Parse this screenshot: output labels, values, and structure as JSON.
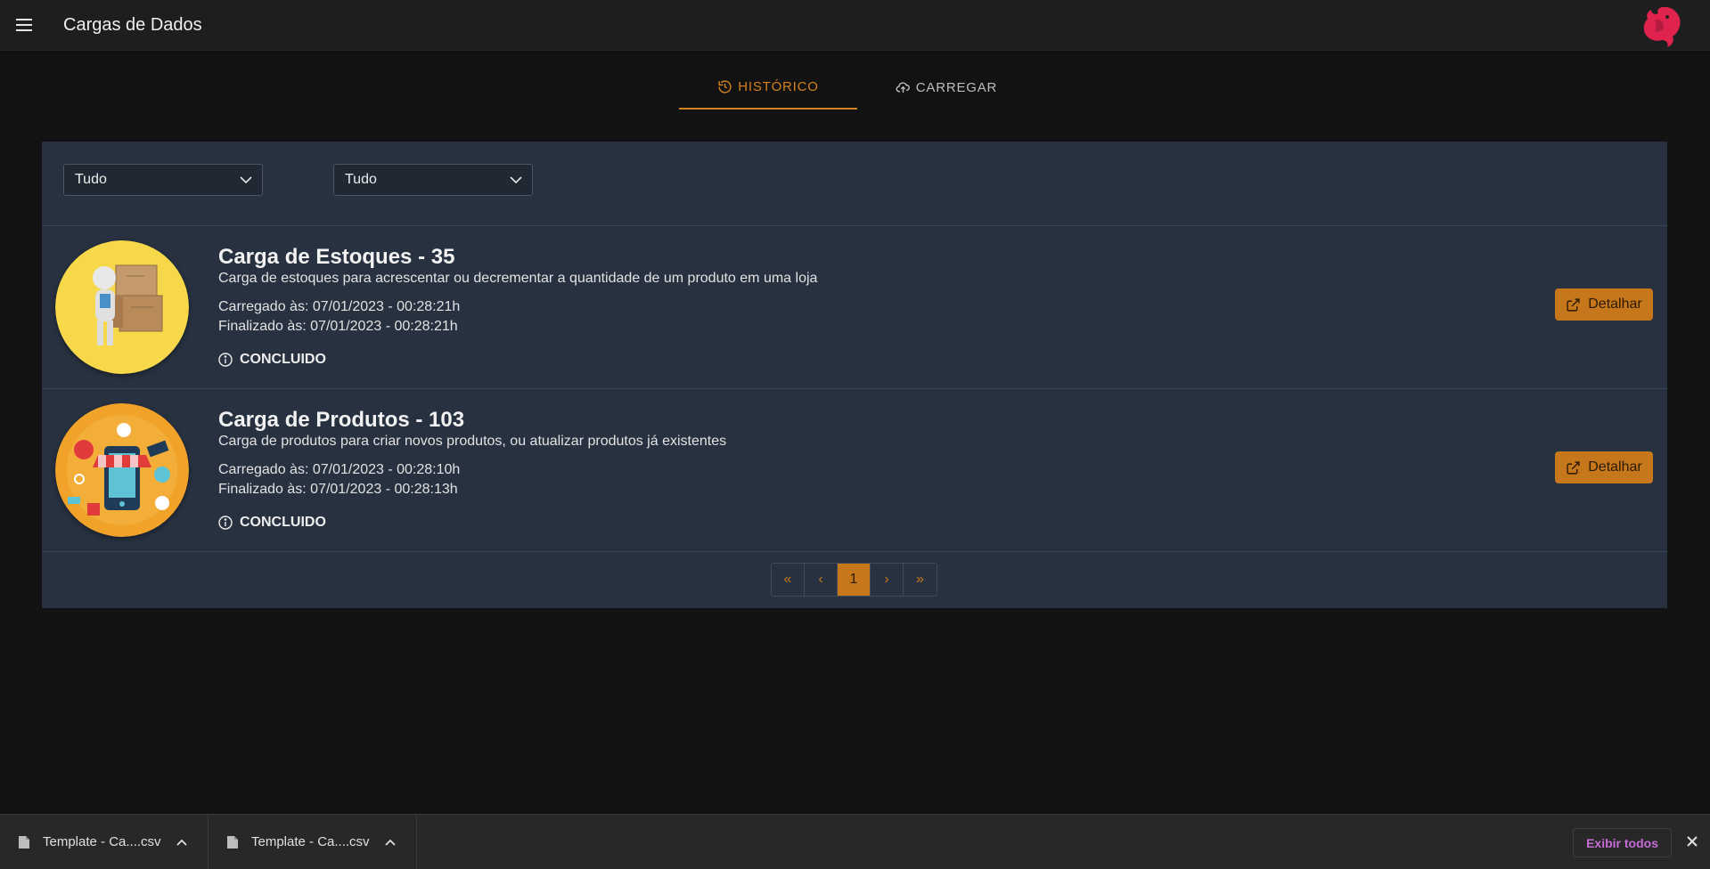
{
  "appbar": {
    "title": "Cargas de Dados"
  },
  "tabs": [
    {
      "label": "HISTÓRICO",
      "icon": "history-icon",
      "active": true
    },
    {
      "label": "CARREGAR",
      "icon": "cloud-upload-icon",
      "active": false
    }
  ],
  "filters": [
    {
      "value": "Tudo"
    },
    {
      "value": "Tudo"
    }
  ],
  "items": [
    {
      "title": "Carga de Estoques - 35",
      "description": "Carga de estoques para acrescentar ou decrementar a quantidade de um produto em uma loja",
      "loaded": "Carregado às: 07/01/2023 - 00:28:21h",
      "finished": "Finalizado às: 07/01/2023 - 00:28:21h",
      "status": "CONCLUIDO",
      "button": "Detalhar"
    },
    {
      "title": "Carga de Produtos - 103",
      "description": "Carga de produtos para criar novos produtos, ou atualizar produtos já existentes",
      "loaded": "Carregado às: 07/01/2023 - 00:28:10h",
      "finished": "Finalizado às: 07/01/2023 - 00:28:13h",
      "status": "CONCLUIDO",
      "button": "Detalhar"
    }
  ],
  "pagination": {
    "current": "1",
    "first": "«",
    "prev": "‹",
    "next": "›",
    "last": "»"
  },
  "downloads": {
    "files": [
      {
        "name": "Template - Ca....csv"
      },
      {
        "name": "Template - Ca....csv"
      }
    ],
    "show_all": "Exibir todos"
  },
  "colors": {
    "accent": "#c7771b",
    "panel": "#273140",
    "background": "#121212",
    "brand": "#e0234e"
  }
}
